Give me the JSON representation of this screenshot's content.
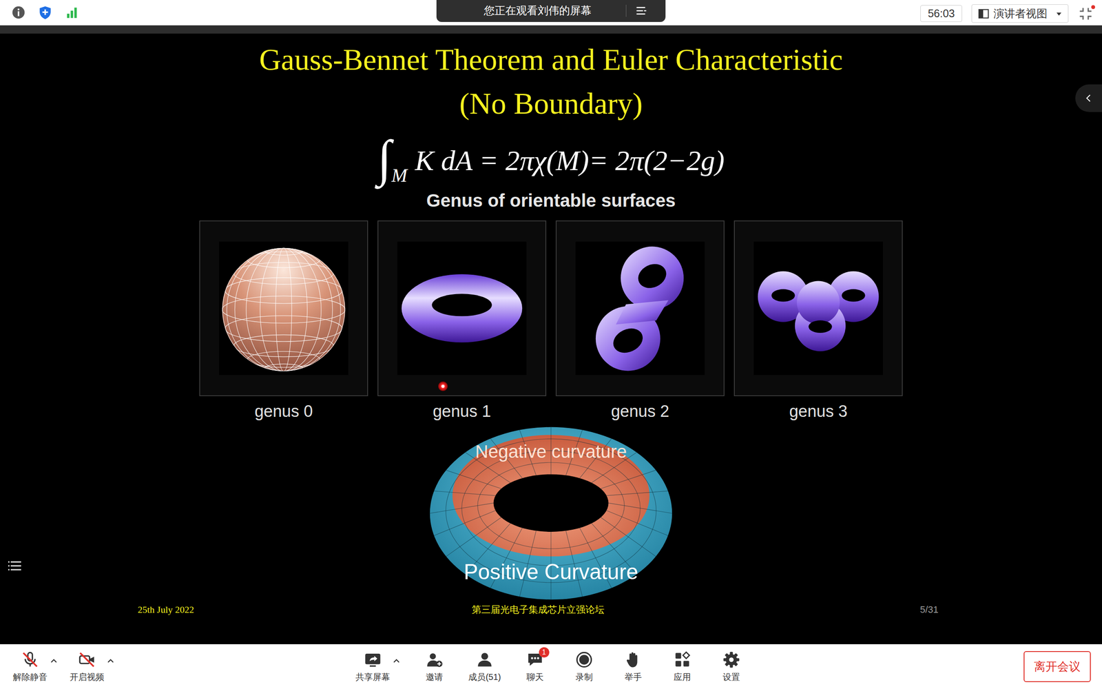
{
  "topbar": {
    "banner": "您正在观看刘伟的屏幕",
    "timer": "56:03",
    "view_mode": "演讲者视图"
  },
  "slide": {
    "title": [
      "Gauss-Bennet Theorem and Euler Characteristic",
      "(No Boundary)"
    ],
    "formula": {
      "integral": "∫",
      "subscript": "M",
      "body": "K dA = 2πχ(M)= 2π(2−2g)"
    },
    "subtitle": "Genus of orientable surfaces",
    "surfaces": [
      {
        "label": "genus 0",
        "kind": "sphere"
      },
      {
        "label": "genus 1",
        "kind": "torus"
      },
      {
        "label": "genus 2",
        "kind": "double"
      },
      {
        "label": "genus 3",
        "kind": "triple"
      }
    ],
    "torus": {
      "inner_label": "Negative curvature",
      "outer_label": "Positive Curvature"
    },
    "footer": {
      "date": "25th July 2022",
      "event": "第三届光电子集成芯片立强论坛",
      "page": "5/31"
    }
  },
  "toolbar": {
    "left": [
      {
        "label": "解除静音",
        "kind": "mic",
        "on": false,
        "has_menu": true
      },
      {
        "label": "开启视频",
        "kind": "camera",
        "on": false,
        "has_menu": true
      }
    ],
    "center": [
      {
        "label": "共享屏幕",
        "kind": "share",
        "has_menu": true,
        "badge": ""
      },
      {
        "label": "邀请",
        "kind": "invite",
        "has_menu": false,
        "badge": ""
      },
      {
        "label": "成员(51)",
        "kind": "members",
        "has_menu": false,
        "badge": ""
      },
      {
        "label": "聊天",
        "kind": "chat",
        "has_menu": false,
        "badge": "1"
      },
      {
        "label": "录制",
        "kind": "record",
        "has_menu": false,
        "badge": ""
      },
      {
        "label": "举手",
        "kind": "hand",
        "has_menu": false,
        "badge": ""
      },
      {
        "label": "应用",
        "kind": "apps",
        "has_menu": false,
        "badge": ""
      },
      {
        "label": "设置",
        "kind": "settings",
        "has_menu": false,
        "badge": ""
      }
    ],
    "leave": "离开会议"
  }
}
